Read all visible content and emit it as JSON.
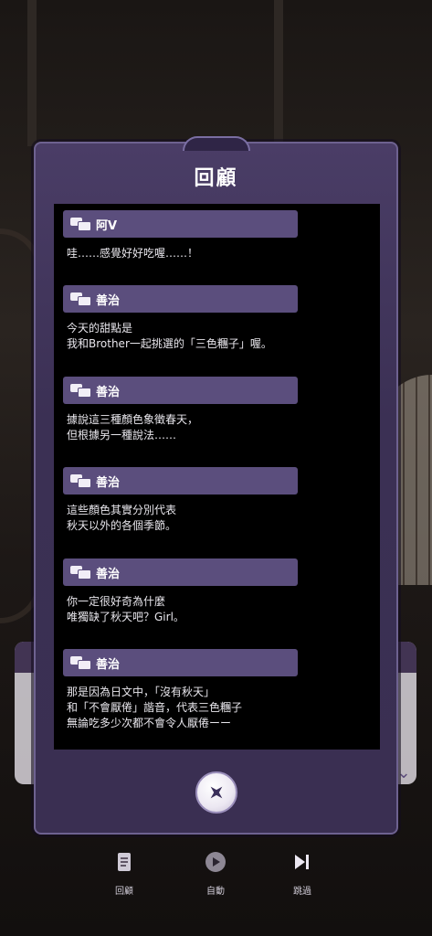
{
  "modal": {
    "title": "回顧",
    "entries": [
      {
        "speaker": "阿V",
        "text": "哇……感覺好好吃喔……！"
      },
      {
        "speaker": "善治",
        "text": "今天的甜點是\n我和Brother一起挑選的「三色糰子」喔。"
      },
      {
        "speaker": "善治",
        "text": "據說這三種顏色象徵春天，\n但根據另一種說法……"
      },
      {
        "speaker": "善治",
        "text": "這些顏色其實分別代表\n秋天以外的各個季節。"
      },
      {
        "speaker": "善治",
        "text": "你一定很好奇為什麼\n唯獨缺了秋天吧？Girl。"
      },
      {
        "speaker": "善治",
        "text": "那是因為日文中，「沒有秋天」\n和「不會厭倦」諧音，代表三色糰子\n無論吃多少次都不會令人厭倦ーー"
      }
    ]
  },
  "controls": {
    "log_label": "回顧",
    "auto_label": "自動",
    "skip_label": "跳過"
  }
}
